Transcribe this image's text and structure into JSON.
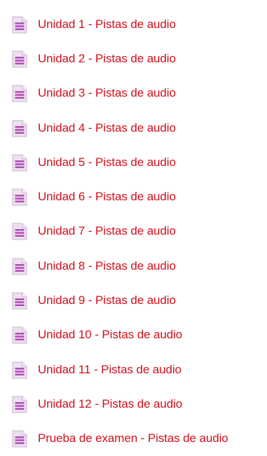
{
  "items": [
    {
      "label": "Unidad 1 - Pistas de audio"
    },
    {
      "label": "Unidad 2 - Pistas de audio"
    },
    {
      "label": "Unidad 3 - Pistas de audio"
    },
    {
      "label": "Unidad 4 - Pistas de audio"
    },
    {
      "label": "Unidad 5 - Pistas de audio"
    },
    {
      "label": "Unidad 6 - Pistas de audio"
    },
    {
      "label": "Unidad 7 - Pistas de audio"
    },
    {
      "label": "Unidad 8 - Pistas de audio"
    },
    {
      "label": "Unidad 9 - Pistas de audio"
    },
    {
      "label": "Unidad 10 - Pistas de audio"
    },
    {
      "label": "Unidad 11 - Pistas de audio"
    },
    {
      "label": "Unidad 12 - Pistas de audio"
    },
    {
      "label": "Prueba de examen - Pistas de audio"
    }
  ],
  "icon": "document-icon",
  "colors": {
    "link": "#d30f1c",
    "icon_page": "#ece1ee",
    "icon_lines": "#b24fb8"
  }
}
